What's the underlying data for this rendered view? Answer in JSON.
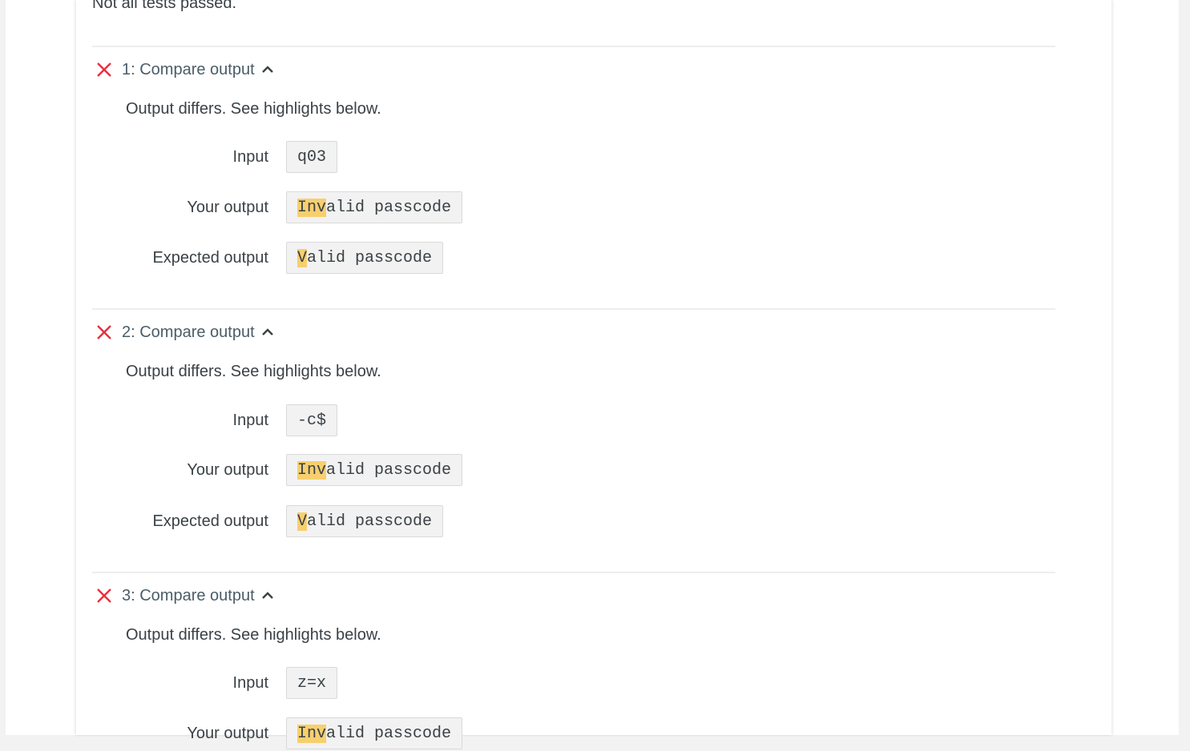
{
  "summary": "Not all tests passed.",
  "colors": {
    "fail": "#e8303e",
    "highlight": "#f7cf6f",
    "code_bg": "#f2f2f2"
  },
  "labels": {
    "input": "Input",
    "your_output": "Your output",
    "expected_output": "Expected output"
  },
  "tests": [
    {
      "title": "1: Compare output",
      "status_icon": "x-icon",
      "toggle_icon": "chevron-up-icon",
      "message": "Output differs. See highlights below.",
      "input": "q03",
      "your_output": {
        "highlight": "Inv",
        "rest": "alid passcode"
      },
      "expected_output": {
        "highlight": "V",
        "rest": "alid passcode"
      }
    },
    {
      "title": "2: Compare output",
      "status_icon": "x-icon",
      "toggle_icon": "chevron-up-icon",
      "message": "Output differs. See highlights below.",
      "input": "-c$",
      "your_output": {
        "highlight": "Inv",
        "rest": "alid passcode"
      },
      "expected_output": {
        "highlight": "V",
        "rest": "alid passcode"
      }
    },
    {
      "title": "3: Compare output",
      "status_icon": "x-icon",
      "toggle_icon": "chevron-up-icon",
      "message": "Output differs. See highlights below.",
      "input": "z=x",
      "your_output": {
        "highlight": "Inv",
        "rest": "alid passcode"
      }
    }
  ]
}
